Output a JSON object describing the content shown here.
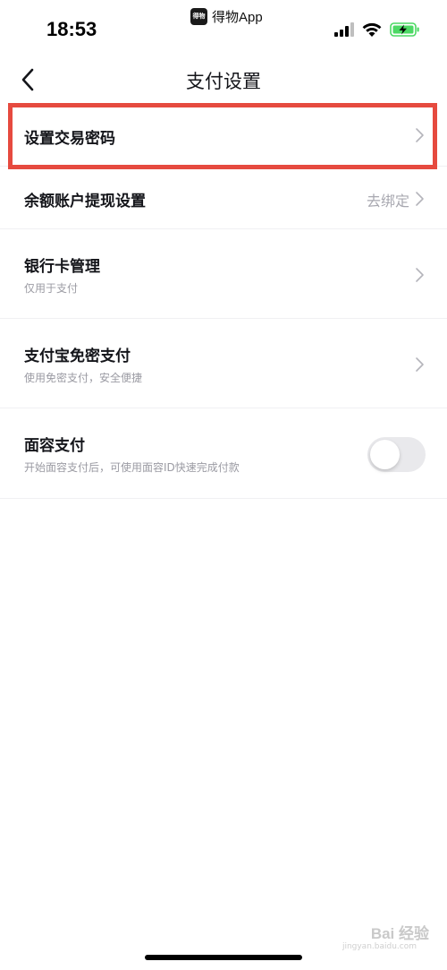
{
  "status_bar": {
    "time": "18:53",
    "app_name": "得物App",
    "app_logo_text": "得物"
  },
  "nav": {
    "title": "支付设置"
  },
  "rows": [
    {
      "title": "设置交易密码"
    },
    {
      "title": "余额账户提现设置",
      "value": "去绑定"
    },
    {
      "title": "银行卡管理",
      "subtitle": "仅用于支付"
    },
    {
      "title": "支付宝免密支付",
      "subtitle": "使用免密支付，安全便捷"
    },
    {
      "title": "面容支付",
      "subtitle": "开始面容支付后，可使用面容ID快速完成付款",
      "toggle_on": false
    }
  ],
  "watermark": {
    "text": "Bai 经验",
    "sub": "jingyan.baidu.com"
  },
  "colors": {
    "highlight": "#e64a3f",
    "battery": "#4cd964"
  }
}
